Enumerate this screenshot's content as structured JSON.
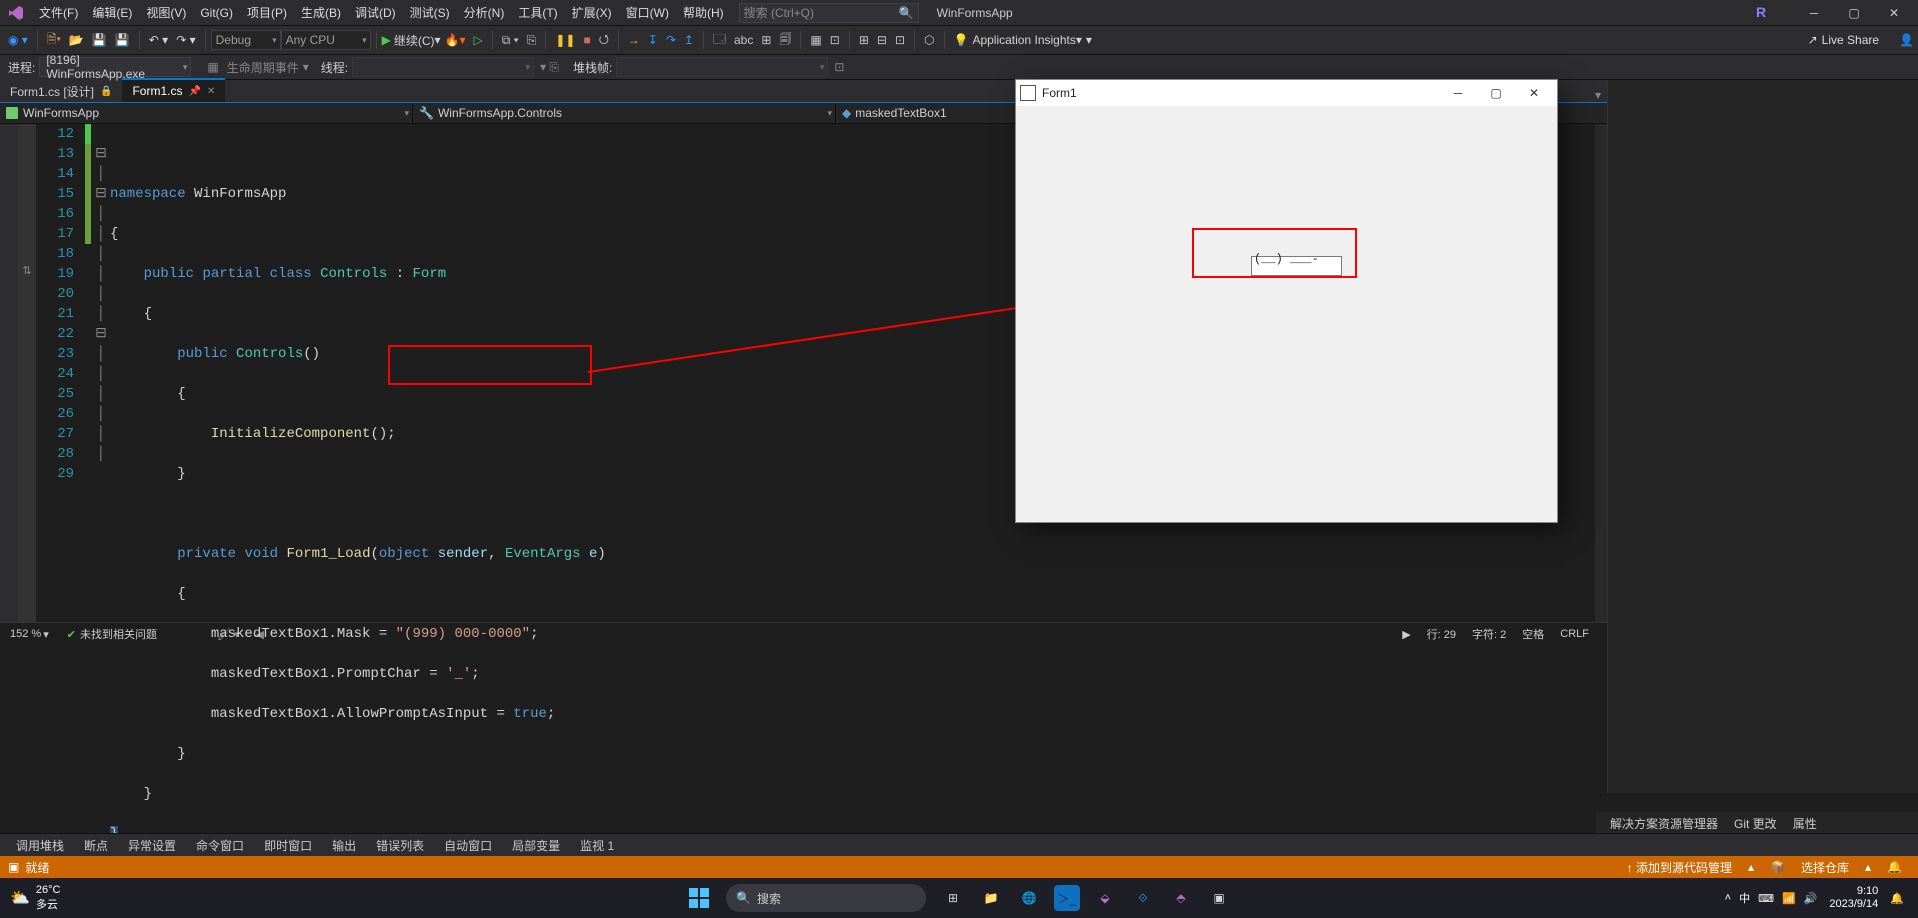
{
  "menubar": {
    "items": [
      "文件(F)",
      "编辑(E)",
      "视图(V)",
      "Git(G)",
      "项目(P)",
      "生成(B)",
      "调试(D)",
      "测试(S)",
      "分析(N)",
      "工具(T)",
      "扩展(X)",
      "窗口(W)",
      "帮助(H)"
    ],
    "search_placeholder": "搜索 (Ctrl+Q)",
    "title": "WinFormsApp",
    "r_icon": "R"
  },
  "toolbar": {
    "config": "Debug",
    "platform": "Any CPU",
    "continue": "继续(C)",
    "app_insights": "Application Insights",
    "liveshare": "Live Share"
  },
  "procbar": {
    "label": "进程:",
    "process": "[8196] WinFormsApp.exe",
    "lifecycle_label": "生命周期事件",
    "thread_label": "线程:",
    "stack_label": "堆栈帧:"
  },
  "tabs": {
    "t1": "Form1.cs [设计]",
    "t2": "Form1.cs"
  },
  "navbar": {
    "project": "WinFormsApp",
    "klass": "WinFormsApp.Controls",
    "member": "maskedTextBox1"
  },
  "code": {
    "lines": {
      "12": "",
      "13": "namespace WinFormsApp",
      "14": "{",
      "15": "    public partial class Controls : Form",
      "16": "    {",
      "17": "        public Controls()",
      "18": "        {",
      "19": "            InitializeComponent();",
      "20": "        }",
      "21": "",
      "22": "        private void Form1_Load(object sender, EventArgs e)",
      "23": "        {",
      "24_a": "            maskedTextBox1.Mask = ",
      "24_b": "\"(999) 000-0000\"",
      "24_c": ";",
      "25_a": "            maskedTextBox1.PromptChar = ",
      "25_b": "'_'",
      "25_c": ";",
      "26_a": "            maskedTextBox1.AllowPromptAsInput = ",
      "26_b": "true",
      "26_c": ";",
      "27": "        }",
      "28": "    }",
      "29": "}"
    }
  },
  "statbar1": {
    "zoom": "152 %",
    "issues": "未找到相关问题",
    "ln": "行: 29",
    "ch": "字符: 2",
    "spc": "空格",
    "crlf": "CRLF"
  },
  "prop_tabs": {
    "a": "解决方案资源管理器",
    "b": "Git 更改",
    "c": "属性"
  },
  "bottom_tools": {
    "a": "调用堆栈",
    "b": "断点",
    "c": "异常设置",
    "d": "命令窗口",
    "e": "即时窗口",
    "f": "输出",
    "g": "错误列表",
    "h": "自动窗口",
    "i": "局部变量",
    "j": "监视 1"
  },
  "statusbar": {
    "ready": "就绪",
    "src": "↑ 添加到源代码管理",
    "repo": "选择仓库"
  },
  "formwin": {
    "title": "Form1",
    "masked_value": "(__) ___-____"
  },
  "taskbar": {
    "temp": "26°C",
    "cond": "多云",
    "search": "搜索",
    "ime": "中",
    "time": "9:10",
    "date": "2023/9/14"
  }
}
